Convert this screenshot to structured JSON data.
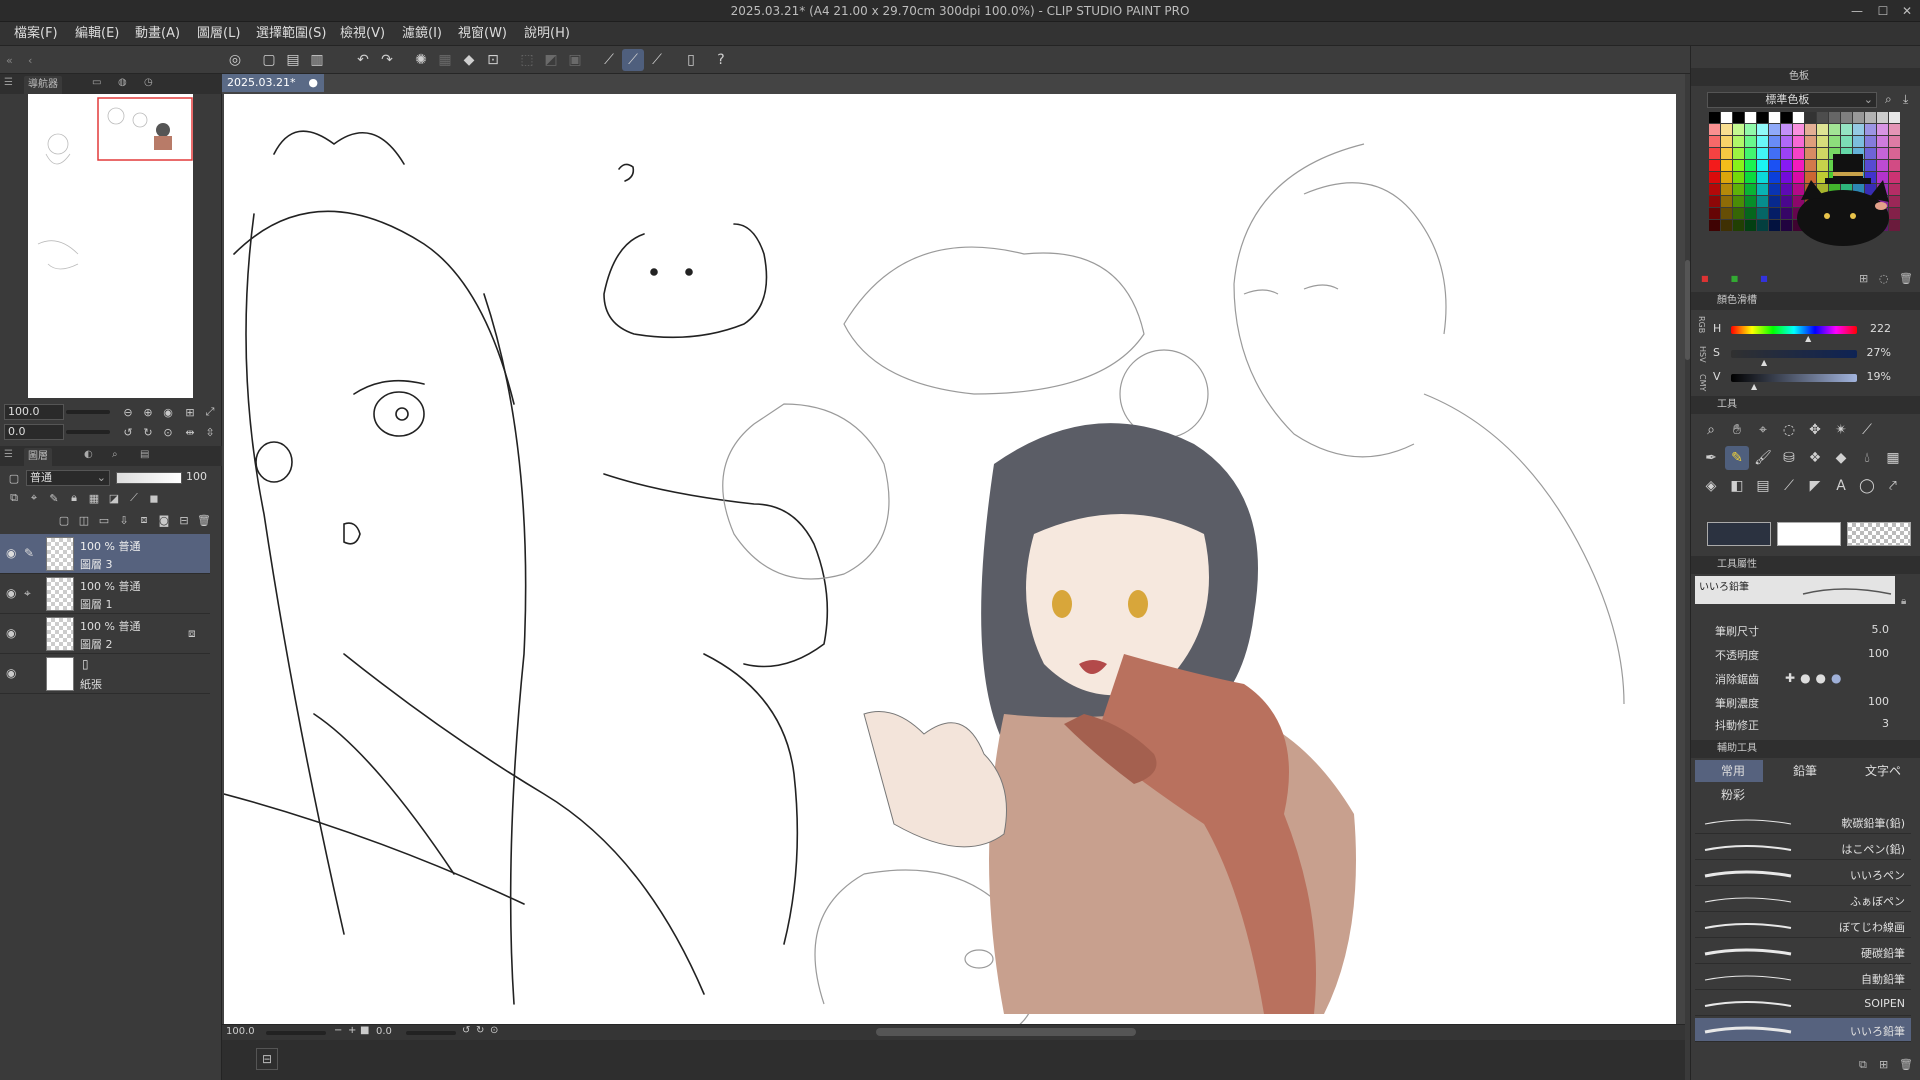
{
  "window": {
    "title": "2025.03.21* (A4 21.00 x 29.70cm 300dpi 100.0%)  - CLIP STUDIO PAINT PRO",
    "controls": [
      "—",
      "☐",
      "✕"
    ]
  },
  "menu": [
    "檔案(F)",
    "編輯(E)",
    "動畫(A)",
    "圖層(L)",
    "選擇範圍(S)",
    "檢視(V)",
    "濾鏡(I)",
    "視窗(W)",
    "說明(H)"
  ],
  "navigator": {
    "tabs": [
      "導航器"
    ],
    "zoom": "100.0",
    "rotation": "0.0"
  },
  "layers": {
    "tab": "圖層",
    "blend_mode": "普通",
    "opacity": "100",
    "items": [
      {
        "opacity_mode": "100 % 普通",
        "name": "圖層 3",
        "selected": true
      },
      {
        "opacity_mode": "100 % 普通",
        "name": "圖層 1",
        "selected": false
      },
      {
        "opacity_mode": "100 % 普通",
        "name": "圖層 2",
        "selected": false
      },
      {
        "opacity_mode": "",
        "name": "紙張",
        "selected": false
      }
    ]
  },
  "document": {
    "tab_label": "2025.03.21*"
  },
  "status": {
    "zoom": "100.0",
    "rotation": "0.0"
  },
  "colorset": {
    "tab": "色板",
    "set_name": "標準色板"
  },
  "color_slider": {
    "title": "顏色滑槽",
    "h_label": "H",
    "h_value": "222",
    "s_label": "S",
    "s_value": "27%",
    "v_label": "V",
    "v_value": "19%",
    "hue_fraction": 0.62,
    "sat_fraction": 0.27,
    "val_fraction": 0.19,
    "side_labels": [
      "RGB",
      "HSV",
      "CMY"
    ]
  },
  "tool_panel": {
    "title": "工具",
    "main_color": "#2b3240",
    "sub_color": "#ffffff"
  },
  "tool_property": {
    "title": "工具屬性",
    "brush_name": "いいろ鉛筆",
    "rows": [
      {
        "label": "筆刷尺寸",
        "value": "5.0"
      },
      {
        "label": "不透明度",
        "value": "100"
      },
      {
        "label": "消除鋸齒",
        "value": ""
      },
      {
        "label": "筆刷濃度",
        "value": "100"
      },
      {
        "label": "抖動修正",
        "value": "3"
      }
    ]
  },
  "sub_tool": {
    "title": "輔助工具",
    "groups": [
      "常用",
      "鉛筆",
      "文字ペ",
      "粉彩"
    ],
    "brushes": [
      "軟碳鉛筆(鉛)",
      "はこペン(鉛)",
      "いいろペン",
      "ふぁぼペン",
      "ぼてじわ線画",
      "硬碳鉛筆",
      "自動鉛筆",
      "SOIPEN",
      "いいろ鉛筆"
    ]
  }
}
